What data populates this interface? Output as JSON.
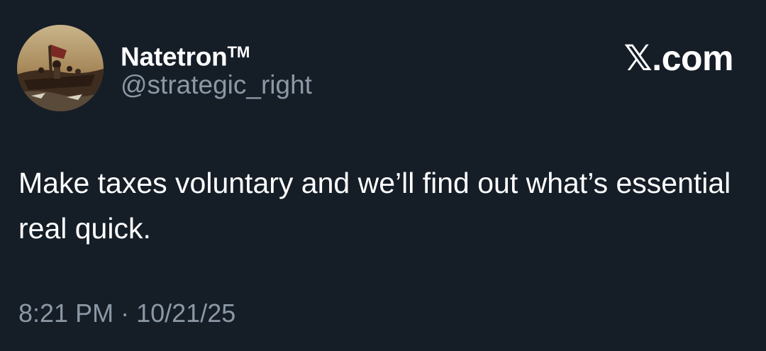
{
  "author": {
    "display_name": "Natetron",
    "trademark": "TM",
    "handle": "@strategic_right",
    "avatar": "painting-avatar"
  },
  "brand": {
    "label": ".com",
    "icon": "x-logo-icon"
  },
  "tweet": {
    "text": "Make taxes voluntary and we’ll find out what’s essential real quick.",
    "time": "8:21 PM",
    "separator": "·",
    "date": "10/21/25"
  },
  "colors": {
    "background": "#151d27",
    "primary_text": "#ffffff",
    "secondary_text": "#8b98a5"
  }
}
